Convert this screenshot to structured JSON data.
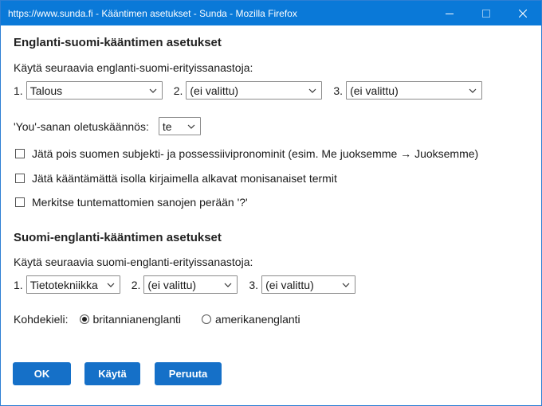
{
  "window": {
    "title": "https://www.sunda.fi - Kääntimen asetukset - Sunda - Mozilla Firefox"
  },
  "en_fi": {
    "heading": "Englanti-suomi-kääntimen asetukset",
    "prompt": "Käytä seuraavia englanti-suomi-erityissanastoja:",
    "selects": [
      {
        "num": "1.",
        "value": "Talous"
      },
      {
        "num": "2.",
        "value": "(ei valittu)"
      },
      {
        "num": "3.",
        "value": "(ei valittu)"
      }
    ],
    "you_label": "'You'-sanan oletuskäännös:",
    "you_value": "te",
    "checkboxes": [
      {
        "label": "Jätä pois suomen subjekti- ja possessiivipronominit  (esim. Me juoksemme → Juoksemme)",
        "checked": false
      },
      {
        "label": "Jätä kääntämättä isolla kirjaimella alkavat monisanaiset termit",
        "checked": false
      },
      {
        "label": "Merkitse tuntemattomien sanojen perään '?'",
        "checked": false
      }
    ]
  },
  "fi_en": {
    "heading": "Suomi-englanti-kääntimen asetukset",
    "prompt": "Käytä seuraavia suomi-englanti-erityissanastoja:",
    "selects": [
      {
        "num": "1.",
        "value": "Tietotekniikka"
      },
      {
        "num": "2.",
        "value": "(ei valittu)"
      },
      {
        "num": "3.",
        "value": "(ei valittu)"
      }
    ],
    "target_label": "Kohdekieli:",
    "target_options": [
      {
        "label": "britannianenglanti",
        "selected": true
      },
      {
        "label": "amerikanenglanti",
        "selected": false
      }
    ]
  },
  "buttons": {
    "ok": "OK",
    "apply": "Käytä",
    "cancel": "Peruuta"
  },
  "colors": {
    "titlebar": "#0a79d8",
    "button": "#1570c8"
  }
}
